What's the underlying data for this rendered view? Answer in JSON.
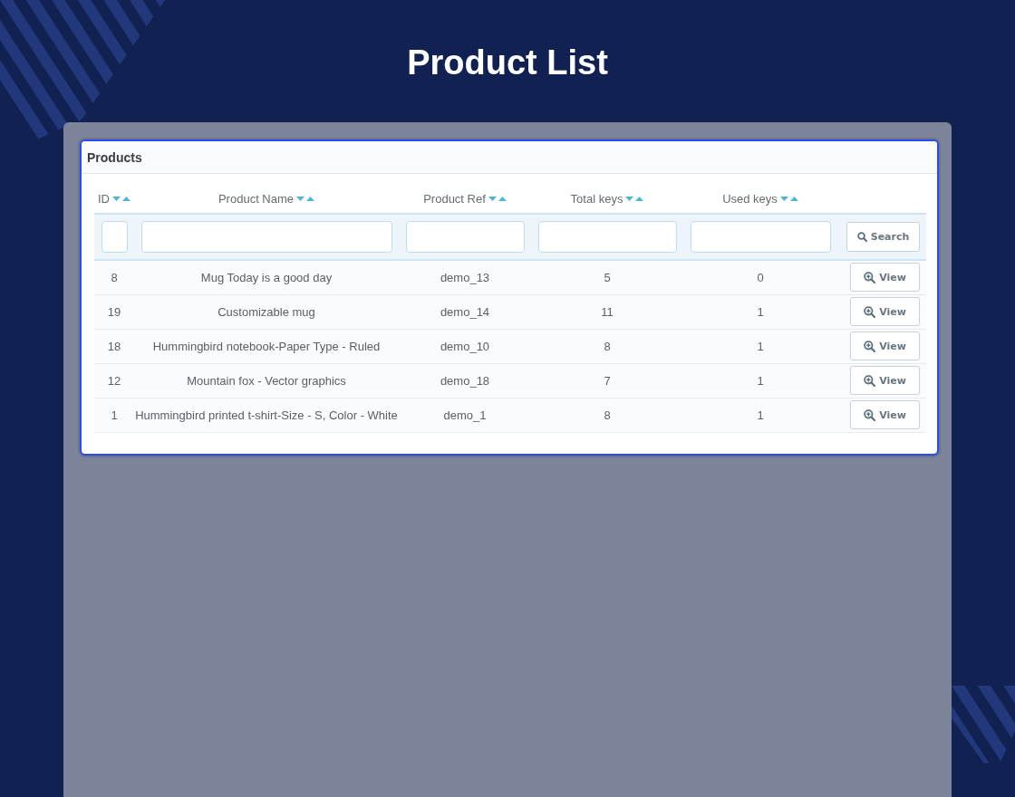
{
  "page": {
    "title": "Product List"
  },
  "card": {
    "title": "Products"
  },
  "table": {
    "columns": [
      "ID",
      "Product Name",
      "Product Ref",
      "Total keys",
      "Used keys"
    ],
    "search_button": "Search",
    "rows": [
      {
        "id": "8",
        "product_name": "Mug Today is a good day",
        "product_ref": "demo_13",
        "total_keys": "5",
        "used_keys": "0",
        "action": "View"
      },
      {
        "id": "19",
        "product_name": "Customizable mug",
        "product_ref": "demo_14",
        "total_keys": "11",
        "used_keys": "1",
        "action": "View"
      },
      {
        "id": "18",
        "product_name": "Hummingbird notebook-Paper Type - Ruled",
        "product_ref": "demo_10",
        "total_keys": "8",
        "used_keys": "1",
        "action": "View"
      },
      {
        "id": "12",
        "product_name": "Mountain fox - Vector graphics",
        "product_ref": "demo_18",
        "total_keys": "7",
        "used_keys": "1",
        "action": "View"
      },
      {
        "id": "1",
        "product_name": "Hummingbird printed t-shirt-Size - S, Color - White",
        "product_ref": "demo_1",
        "total_keys": "8",
        "used_keys": "1",
        "action": "View"
      }
    ]
  }
}
